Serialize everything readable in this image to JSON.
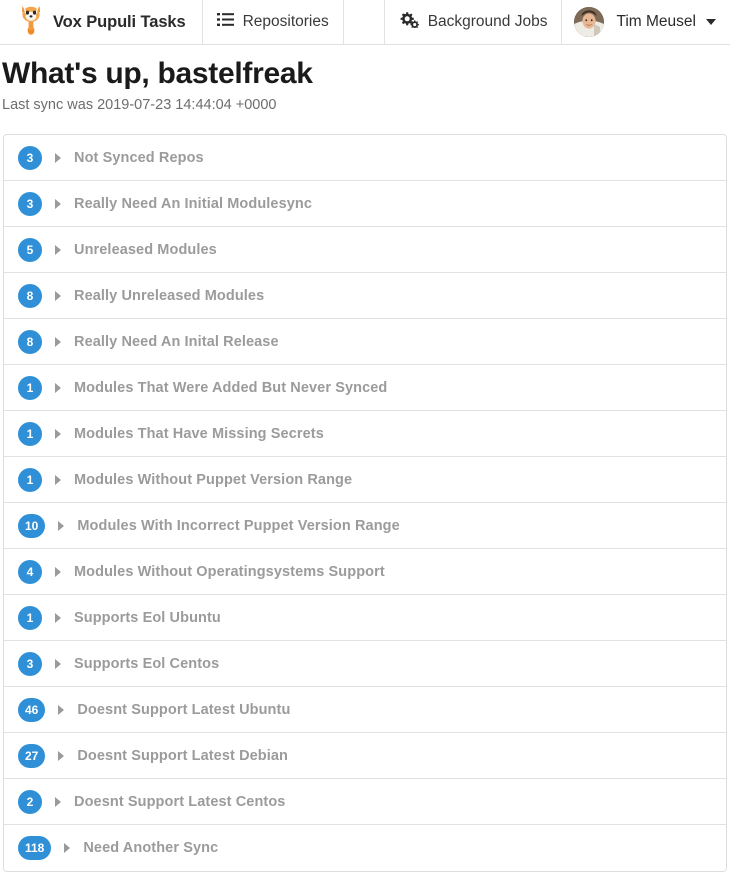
{
  "navbar": {
    "brand": {
      "label": "Vox Pupuli Tasks",
      "icon": "fox-logo-icon"
    },
    "items": [
      {
        "label": "Repositories",
        "icon": "list-icon"
      },
      {
        "label": "Background Jobs",
        "icon": "cogs-icon"
      }
    ],
    "user": {
      "label": "Tim Meusel",
      "avatar": "user-avatar",
      "caret": "chevron-down-icon"
    }
  },
  "header": {
    "title": "What's up, bastelfreak",
    "subtitle": "Last sync was 2019-07-23 14:44:04 +0000"
  },
  "colors": {
    "badge_blue": "#2f90d8",
    "label_gray": "#9b9b9b",
    "border_gray": "#dddddd"
  },
  "tasks": [
    {
      "count": "3",
      "label": "Not Synced Repos"
    },
    {
      "count": "3",
      "label": "Really Need An Initial Modulesync"
    },
    {
      "count": "5",
      "label": "Unreleased Modules"
    },
    {
      "count": "8",
      "label": "Really Unreleased Modules"
    },
    {
      "count": "8",
      "label": "Really Need An Inital Release"
    },
    {
      "count": "1",
      "label": "Modules That Were Added But Never Synced"
    },
    {
      "count": "1",
      "label": "Modules That Have Missing Secrets"
    },
    {
      "count": "1",
      "label": "Modules Without Puppet Version Range"
    },
    {
      "count": "10",
      "label": "Modules With Incorrect Puppet Version Range"
    },
    {
      "count": "4",
      "label": "Modules Without Operatingsystems Support"
    },
    {
      "count": "1",
      "label": "Supports Eol Ubuntu"
    },
    {
      "count": "3",
      "label": "Supports Eol Centos"
    },
    {
      "count": "46",
      "label": "Doesnt Support Latest Ubuntu"
    },
    {
      "count": "27",
      "label": "Doesnt Support Latest Debian"
    },
    {
      "count": "2",
      "label": "Doesnt Support Latest Centos"
    },
    {
      "count": "118",
      "label": "Need Another Sync"
    }
  ]
}
